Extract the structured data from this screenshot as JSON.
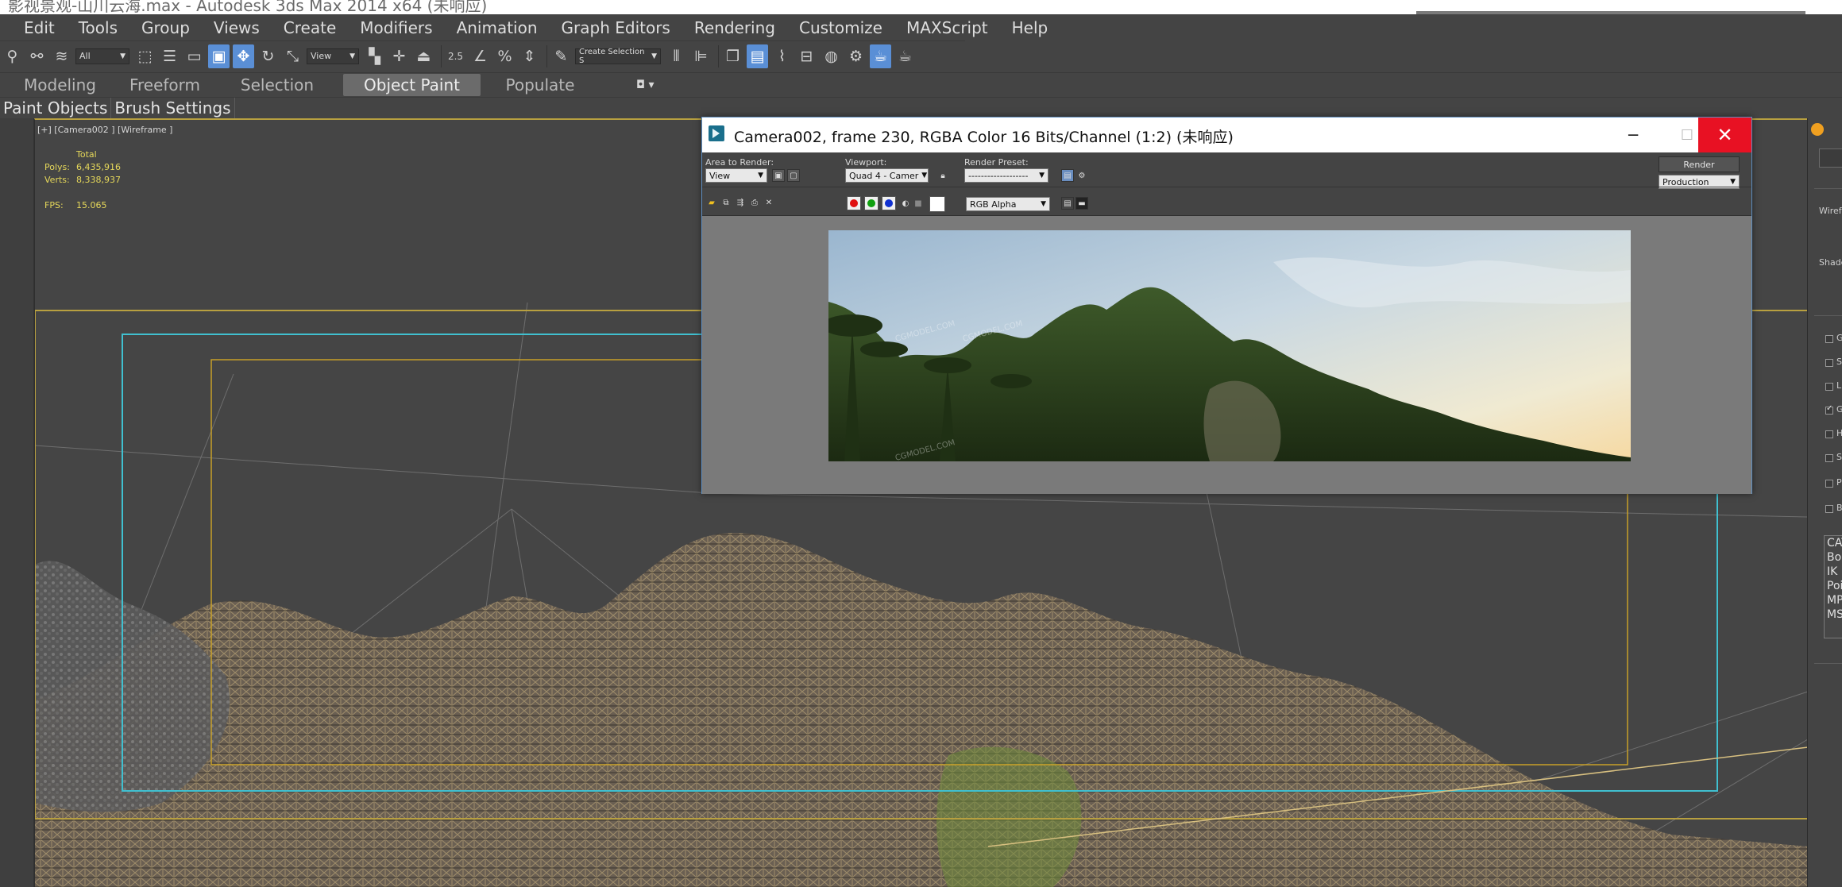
{
  "window": {
    "title": "影视景观-山川云海.max - Autodesk 3ds Max  2014 x64   (未响应)"
  },
  "menu": [
    "Edit",
    "Tools",
    "Group",
    "Views",
    "Create",
    "Modifiers",
    "Animation",
    "Graph Editors",
    "Rendering",
    "Customize",
    "MAXScript",
    "Help"
  ],
  "toolbar": {
    "selection_filter": "All",
    "ref_coord": "View",
    "named_selection_placeholder": "Create Selection S",
    "snap_label": "2.5",
    "angle_snap_label": "%",
    "icons": [
      "link-icon",
      "unlink-icon",
      "bind-spacewarp-icon",
      "select-icon",
      "select-by-name-icon",
      "rect-region-icon",
      "window-crossing-icon",
      "move-icon",
      "rotate-icon",
      "scale-icon",
      "manipulate-icon",
      "keyboard-shortcut-icon",
      "snap-icon",
      "angle-snap-icon",
      "percent-snap-icon",
      "spinner-snap-icon",
      "edit-named-selection-icon",
      "mirror-icon",
      "align-icon",
      "layer-manager-icon",
      "ribbon-icon",
      "curve-editor-icon",
      "schematic-view-icon",
      "material-editor-icon",
      "render-setup-icon",
      "rendered-frame-window-icon",
      "render-production-icon"
    ]
  },
  "ribbon": {
    "tabs": [
      "Modeling",
      "Freeform",
      "Selection",
      "Object Paint",
      "Populate"
    ],
    "active_tab": "Object Paint",
    "sub_tabs": [
      "Paint Objects",
      "Brush Settings"
    ]
  },
  "viewport": {
    "label": "[+] [Camera002 ] [Wireframe ]",
    "stats": {
      "total_label": "Total",
      "polys_label": "Polys:",
      "polys_value": "6,435,916",
      "verts_label": "Verts:",
      "verts_value": "8,338,937",
      "fps_label": "FPS:",
      "fps_value": "15.065"
    }
  },
  "command_panel": {
    "labels": [
      "Wirefr",
      "Shade"
    ],
    "checkbox_labels": [
      "G",
      "S",
      "L",
      "G",
      "H",
      "S",
      "P",
      "B"
    ],
    "checked_index": 3,
    "list_items": [
      "CAT",
      "Bon",
      "IK",
      "Poi",
      "MP",
      "MS"
    ]
  },
  "render_window": {
    "title": "Camera002, frame 230, RGBA Color 16 Bits/Channel (1:2) (未响应)",
    "area_to_render_label": "Area to Render:",
    "area_to_render_value": "View",
    "viewport_label": "Viewport:",
    "viewport_value": "Quad 4 - Camer",
    "render_preset_label": "Render Preset:",
    "render_preset_value": "-------------------",
    "render_button": "Render",
    "render_mode_value": "Production",
    "channel_display_value": "RGB Alpha",
    "channel_colors": [
      "#e01010",
      "#10a010",
      "#1030d0"
    ],
    "icons": [
      "save-image-icon",
      "copy-image-icon",
      "clone-window-icon",
      "print-image-icon",
      "clear-icon",
      "lock-icon",
      "display-alpha-icon",
      "toggle-ui-overlay-icon"
    ],
    "minimize_icon": "minimize-icon",
    "maximize_icon": "maximize-icon",
    "close_icon": "close-icon",
    "watermark": "CGMODEL.COM"
  },
  "colors": {
    "active_tool": "#5a8fd6",
    "viewport_border": "#b8a040",
    "safe_frame_cyan": "#40c0d0",
    "stats_text": "#e6d85a",
    "close_button": "#e81123"
  }
}
